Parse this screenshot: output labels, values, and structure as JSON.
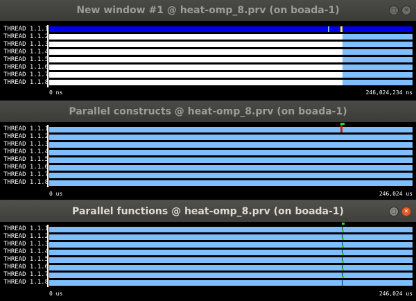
{
  "windows": [
    {
      "title": "New window #1 @ heat-omp_8.prv (on boada-1)",
      "active": false,
      "axis_start": "0 ns",
      "axis_end": "246,024,234 ns",
      "threads": [
        "THREAD 1.1.1",
        "THREAD 1.1.2",
        "THREAD 1.1.3",
        "THREAD 1.1.4",
        "THREAD 1.1.5",
        "THREAD 1.1.6",
        "THREAD 1.1.7",
        "THREAD 1.1.8"
      ]
    },
    {
      "title": "Parallel constructs @ heat-omp_8.prv (on boada-1)",
      "active": false,
      "axis_start": "0 us",
      "axis_end": "246,024 us",
      "threads": [
        "THREAD 1.1.1",
        "THREAD 1.1.2",
        "THREAD 1.1.3",
        "THREAD 1.1.4",
        "THREAD 1.1.5",
        "THREAD 1.1.6",
        "THREAD 1.1.7",
        "THREAD 1.1.8"
      ]
    },
    {
      "title": "Parallel functions @ heat-omp_8.prv (on boada-1)",
      "active": true,
      "axis_start": "0 us",
      "axis_end": "246,024 us",
      "threads": [
        "THREAD 1.1.1",
        "THREAD 1.1.2",
        "THREAD 1.1.3",
        "THREAD 1.1.4",
        "THREAD 1.1.5",
        "THREAD 1.1.6",
        "THREAD 1.1.7",
        "THREAD 1.1.8"
      ]
    }
  ],
  "window_buttons": {
    "maximize_icon": "maximize-icon",
    "close_icon": "close-icon"
  },
  "colors": {
    "running": "#0000e6",
    "idle": "#ffffff",
    "parallel": "#7fbfff",
    "event_green": "#19e619",
    "event_red": "#d11919",
    "event_yellow": "#f2f22e",
    "background": "#000000"
  }
}
